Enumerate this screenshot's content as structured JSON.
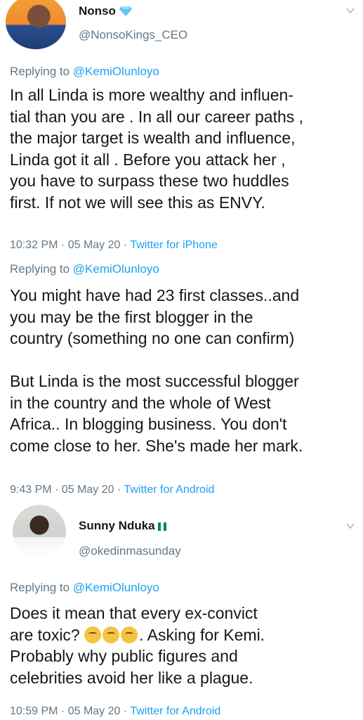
{
  "tweet1": {
    "name": "Nonso",
    "verified_icon": "verified-diamond-icon",
    "handle": "@NonsoKings_CEO",
    "reply_prefix": "Replying to ",
    "reply_mention": "@KemiOlunloyo",
    "text": "In all Linda is more wealthy and influen-\ntial than you are . In all our career paths ,\nthe major target is wealth and influence,\nLinda got it all . Before you attack her ,\nyou have to surpass these two huddles\nfirst. If not we will see this as ENVY.",
    "time": "10:32 PM · 05 May 20 · ",
    "source": "Twitter for iPhone"
  },
  "tweet2": {
    "reply_prefix": "Replying to ",
    "reply_mention": "@KemiOlunloyo",
    "text": "You might have had 23 first classes..and\nyou may be the first blogger in the\ncountry (something no one can confirm)\n\nBut Linda is the most successful blogger\nin the country and the whole of West\nAfrica.. In blogging business. You don't\ncome close to her. She's made her mark.",
    "time": "9:43 PM · 05 May 20 · ",
    "source": "Twitter for Android"
  },
  "tweet3": {
    "name": "Sunny Nduka",
    "flag_icon": "nigeria-flag-icon",
    "handle": "@okedinmasunday",
    "reply_prefix": "Replying to ",
    "reply_mention": "@KemiOlunloyo",
    "text_part1": "Does it mean that every ex-convict\nare toxic? ",
    "emoji_icon": "thinking-face-emoji-icon",
    "text_part2": ". Asking for Kemi.\nProbably why public figures and\ncelebrities avoid her like a plague.",
    "time": "10:59 PM · 05 May 20 · ",
    "source": "Twitter for Android"
  },
  "colors": {
    "text": "#14171a",
    "secondary": "#657786",
    "link": "#1da1f2"
  }
}
